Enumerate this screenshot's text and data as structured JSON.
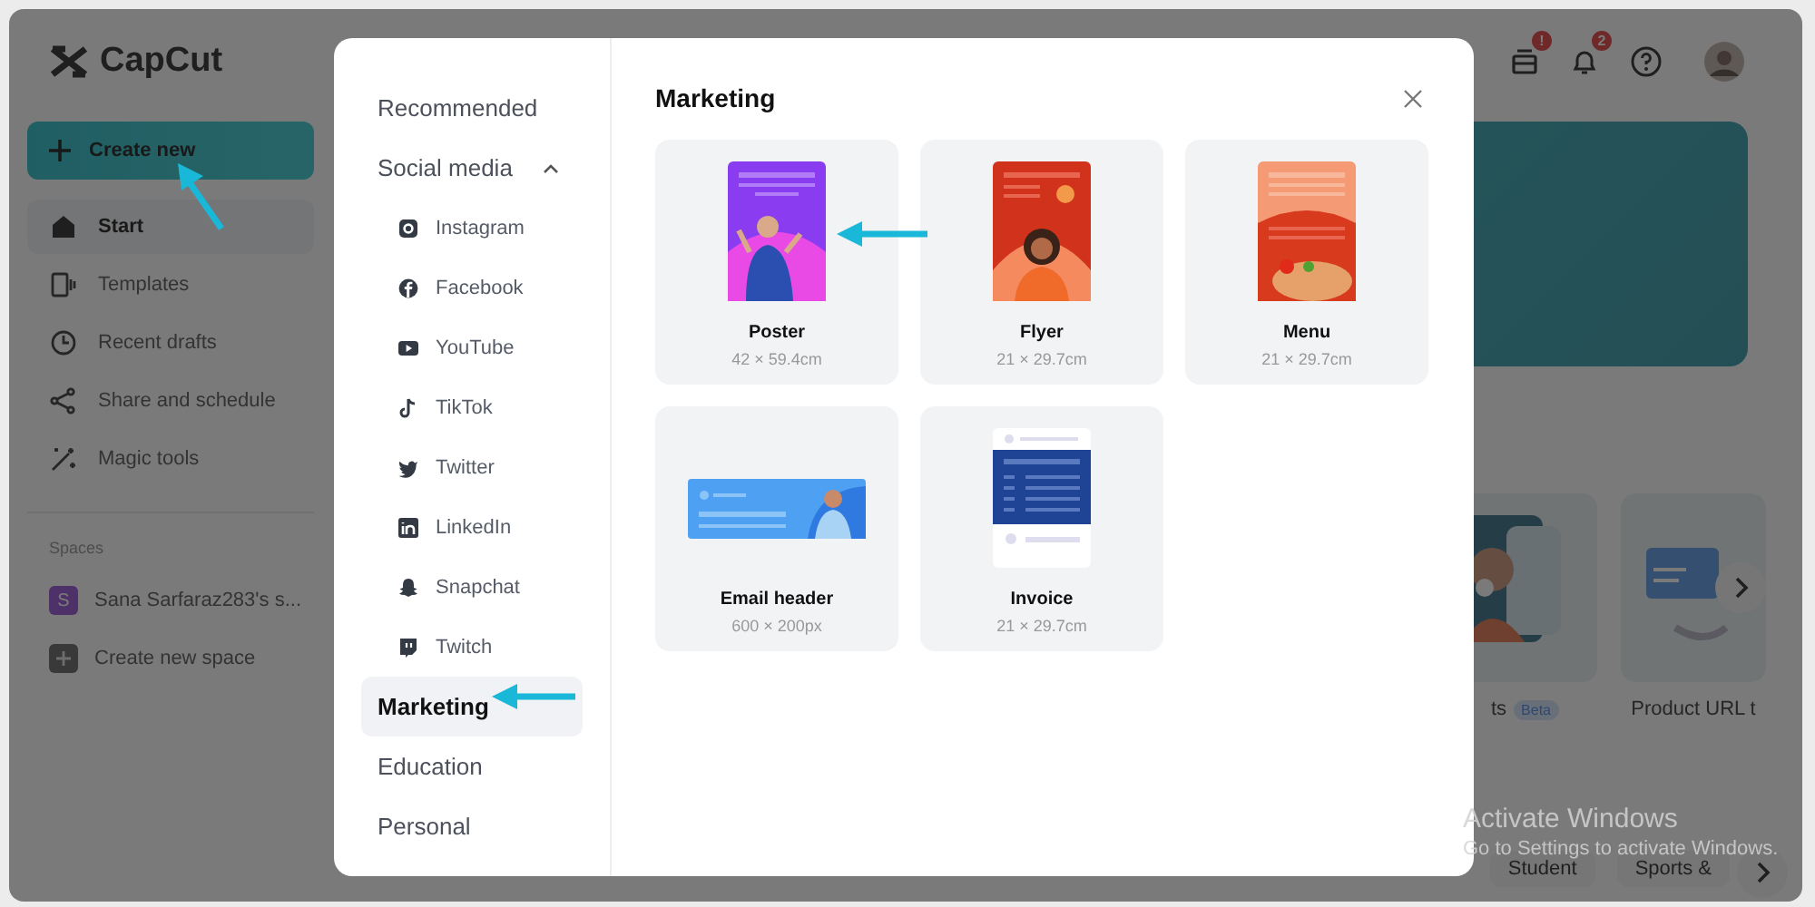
{
  "app": {
    "logo": "CapCut",
    "create_button": "Create new",
    "nav": [
      {
        "label": "Start",
        "selected": true
      },
      {
        "label": "Templates",
        "selected": false
      },
      {
        "label": "Recent drafts",
        "selected": false
      },
      {
        "label": "Share and schedule",
        "selected": false
      },
      {
        "label": "Magic tools",
        "selected": false
      }
    ],
    "spaces_heading": "Spaces",
    "spaces": [
      {
        "kind": "space",
        "initial": "S",
        "name": "Sana Sarfaraz283's s..."
      },
      {
        "kind": "add",
        "name": "Create new space"
      }
    ],
    "header_badges": [
      "!",
      "2"
    ],
    "cards": [
      {
        "label": "ts",
        "tag": "Beta"
      },
      {
        "label": "Product URL t"
      }
    ],
    "chips": [
      "Student",
      "Sports &"
    ]
  },
  "modal": {
    "title": "Marketing",
    "categories": [
      {
        "label": "Recommended",
        "selected": false
      },
      {
        "label": "Social media",
        "selected": false,
        "expanded": true,
        "children": [
          {
            "label": "Instagram",
            "selected": false
          },
          {
            "label": "Facebook",
            "selected": false
          },
          {
            "label": "YouTube",
            "selected": false
          },
          {
            "label": "TikTok",
            "selected": false
          },
          {
            "label": "Twitter",
            "selected": false
          },
          {
            "label": "LinkedIn",
            "selected": false
          },
          {
            "label": "Snapchat",
            "selected": false
          },
          {
            "label": "Twitch",
            "selected": false
          }
        ]
      },
      {
        "label": "Marketing",
        "selected": true
      },
      {
        "label": "Education",
        "selected": false
      },
      {
        "label": "Personal",
        "selected": false
      }
    ],
    "templates": [
      {
        "kind": "poster",
        "name": "Poster",
        "size": "42 × 59.4cm"
      },
      {
        "kind": "flyer",
        "name": "Flyer",
        "size": "21 × 29.7cm"
      },
      {
        "kind": "menu",
        "name": "Menu",
        "size": "21 × 29.7cm"
      },
      {
        "kind": "email",
        "name": "Email header",
        "size": "600 × 200px"
      },
      {
        "kind": "invoice",
        "name": "Invoice",
        "size": "21 × 29.7cm"
      }
    ]
  },
  "os_notice": {
    "title": "Activate Windows",
    "subtitle": "Go to Settings to activate Windows."
  }
}
